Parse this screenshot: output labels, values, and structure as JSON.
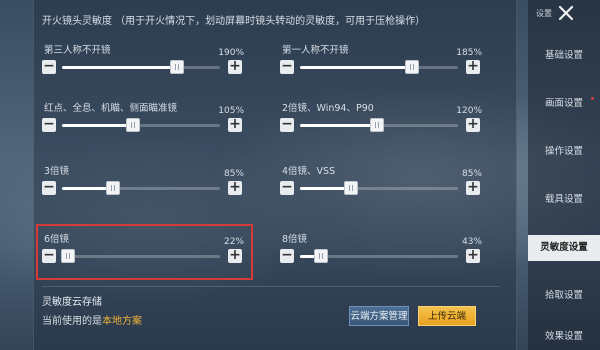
{
  "section": {
    "title": "开火镜头灵敏度 （用于开火情况下，划动屏幕时镜头转动的灵敏度，可用于压枪操作）"
  },
  "sliders": [
    {
      "key": "tpp_noscope",
      "label": "第三人称不开镜",
      "value": "190%",
      "fraction": 0.73
    },
    {
      "key": "fpp_noscope",
      "label": "第一人称不开镜",
      "value": "185%",
      "fraction": 0.71
    },
    {
      "key": "reddot_holo",
      "label": "红点、全息、机瞄、侧面瞄准镜",
      "value": "105%",
      "fraction": 0.45
    },
    {
      "key": "scope_2x",
      "label": "2倍镜、Win94、P90",
      "value": "120%",
      "fraction": 0.49
    },
    {
      "key": "scope_3x",
      "label": "3倍镜",
      "value": "85%",
      "fraction": 0.32
    },
    {
      "key": "scope_4x",
      "label": "4倍镜、VSS",
      "value": "85%",
      "fraction": 0.32
    },
    {
      "key": "scope_6x",
      "label": "6倍镜",
      "value": "22%",
      "fraction": 0.04
    },
    {
      "key": "scope_8x",
      "label": "8倍镜",
      "value": "43%",
      "fraction": 0.13
    }
  ],
  "controls": {
    "minus": "−",
    "plus": "+"
  },
  "cloud": {
    "title": "灵敏度云存储",
    "current_prefix": "当前使用的是",
    "current_plan": "本地方案",
    "manage_button": "云端方案管理",
    "upload_button": "上传云端"
  },
  "sidebar": {
    "settings_label": "设置",
    "items": [
      {
        "label": "基础设置",
        "badge": false
      },
      {
        "label": "画面设置",
        "badge": true
      },
      {
        "label": "操作设置",
        "badge": false
      },
      {
        "label": "载具设置",
        "badge": false
      },
      {
        "label": "灵敏度设置",
        "badge": false,
        "active": true
      },
      {
        "label": "拾取设置",
        "badge": false
      },
      {
        "label": "效果设置",
        "badge": false
      }
    ]
  },
  "colors": {
    "highlight": "#d83a3a",
    "accent": "#f0b43a",
    "upload": "#e8a21f"
  }
}
